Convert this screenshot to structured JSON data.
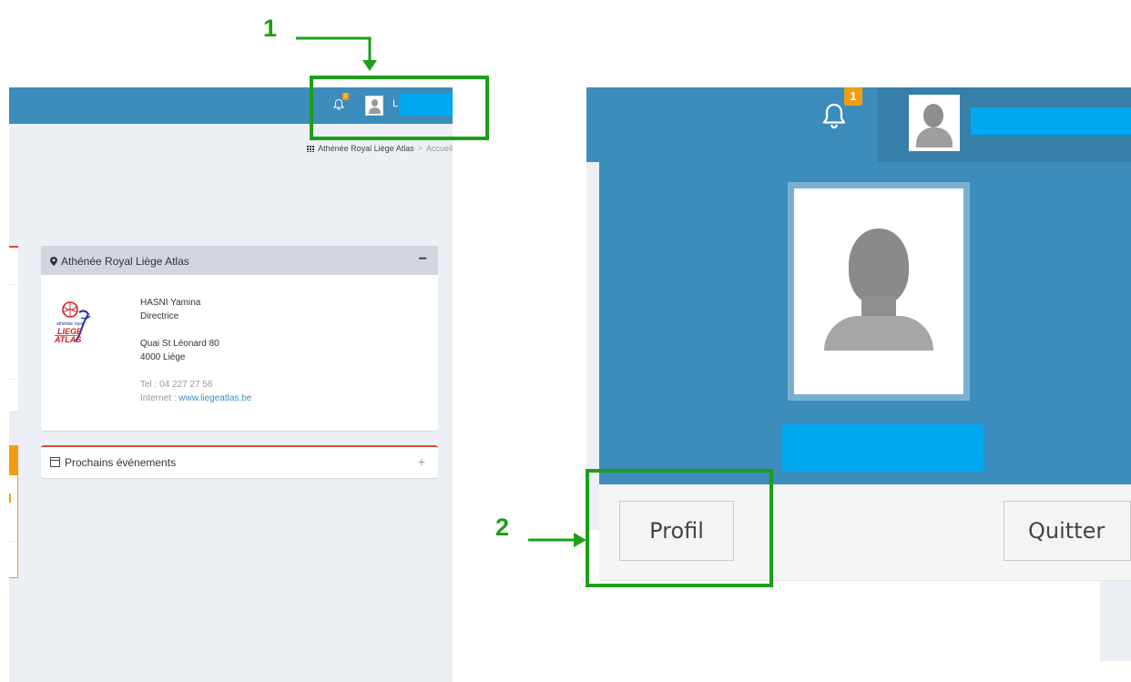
{
  "left_panel": {
    "header": {
      "notification_count": "1",
      "user_initial": "L"
    },
    "breadcrumb": {
      "school": "Athénée Royal Liège Atlas",
      "current": "Accueil"
    },
    "school_card": {
      "title": "Athénée Royal Liège Atlas",
      "collapse_symbol": "−",
      "logo_text_top": "athénée royal",
      "logo_text_mid": "LIEGE",
      "logo_text_bot": "ATLAS",
      "contact_name": "HASNI Yamina",
      "contact_role": "Directrice",
      "address_line1": "Quai St Léonard 80",
      "address_line2": "4000 Liège",
      "tel": "Tel : 04 227 27 56",
      "internet_label": "Internet : ",
      "internet_link": "www.liegeatlas.be"
    },
    "events_card": {
      "title": "Prochains événements",
      "expand_symbol": "+"
    }
  },
  "right_panel": {
    "notification_count": "1",
    "buttons": {
      "profile": "Profil",
      "logout": "Quitter"
    }
  },
  "annotations": {
    "step1": "1",
    "step2": "2"
  },
  "colors": {
    "header_blue": "#3c8dbc",
    "annotation_green": "#1e9e19",
    "redaction": "#00a8f0",
    "badge": "#f39c12"
  }
}
